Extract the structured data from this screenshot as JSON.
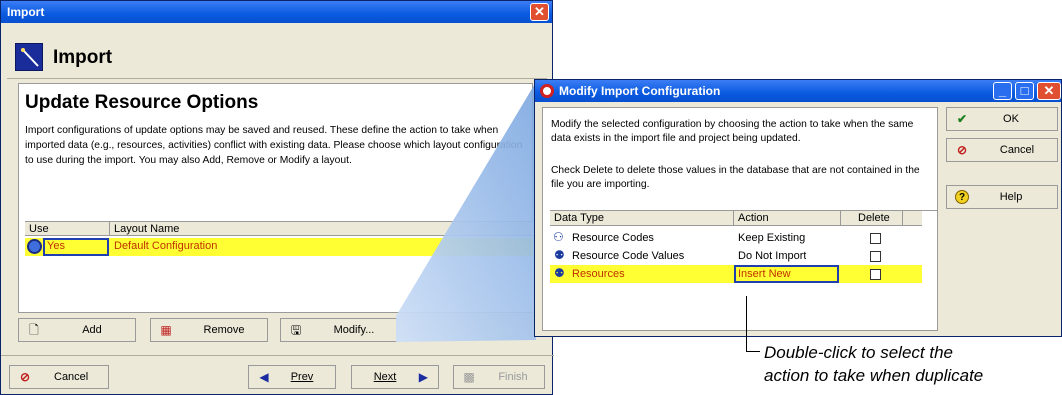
{
  "import_dialog": {
    "title": "Import",
    "header_title": "Import",
    "section_title": "Update Resource Options",
    "description": "Import configurations of update options may be saved and reused.  These define the action to take when imported data (e.g., resources, activities) conflict with existing data.  Please choose which layout configuration to use during the import. You may also Add, Remove or Modify a layout.",
    "table": {
      "col_use": "Use",
      "col_layout": "Layout Name",
      "rows": [
        {
          "use": "Yes",
          "layout": "Default Configuration"
        }
      ]
    },
    "buttons": {
      "add": "Add",
      "remove": "Remove",
      "modify": "Modify...",
      "cancel": "Cancel",
      "prev": "Prev",
      "next": "Next",
      "finish": "Finish"
    }
  },
  "modify_dialog": {
    "title": "Modify Import Configuration",
    "text1": "Modify the selected configuration by choosing the action to take when the same data exists in the import file and project being updated.",
    "text2": "Check Delete to delete those values in the database that are not contained in the file you are importing.",
    "table": {
      "col_type": "Data Type",
      "col_action": "Action",
      "col_delete": "Delete",
      "rows": [
        {
          "type": "Resource Codes",
          "action": "Keep Existing"
        },
        {
          "type": "Resource Code Values",
          "action": "Do Not Import"
        },
        {
          "type": "Resources",
          "action": "Insert New"
        }
      ]
    },
    "buttons": {
      "ok": "OK",
      "cancel": "Cancel",
      "help": "Help"
    }
  },
  "callout": {
    "line1": "Double-click to select the",
    "line2": "action to take when duplicate"
  }
}
